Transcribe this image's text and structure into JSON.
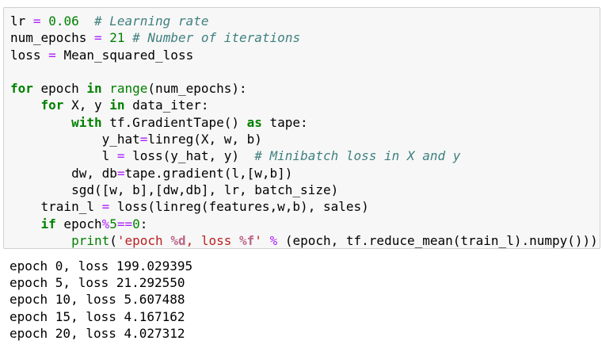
{
  "code": {
    "lines": [
      "lr = 0.06  # Learning rate",
      "num_epochs = 21 # Number of iterations",
      "loss = Mean_squared_loss",
      "",
      "for epoch in range(num_epochs):",
      "    for X, y in data_iter:",
      "        with tf.GradientTape() as tape:",
      "            y_hat=linreg(X, w, b)",
      "            l = loss(y_hat, y)  # Minibatch loss in X and y",
      "        dw, db=tape.gradient(l,[w,b])",
      "        sgd([w, b],[dw,db], lr, batch_size)",
      "    train_l = loss(linreg(features,w,b), sales)",
      "    if epoch%5==0:",
      "        print('epoch %d, loss %f' % (epoch, tf.reduce_mean(train_l).numpy()))"
    ]
  },
  "output": {
    "lines": [
      "epoch 0, loss 199.029395",
      "epoch 5, loss 21.292550",
      "epoch 10, loss 5.607488",
      "epoch 15, loss 4.167162",
      "epoch 20, loss 4.027312"
    ]
  }
}
